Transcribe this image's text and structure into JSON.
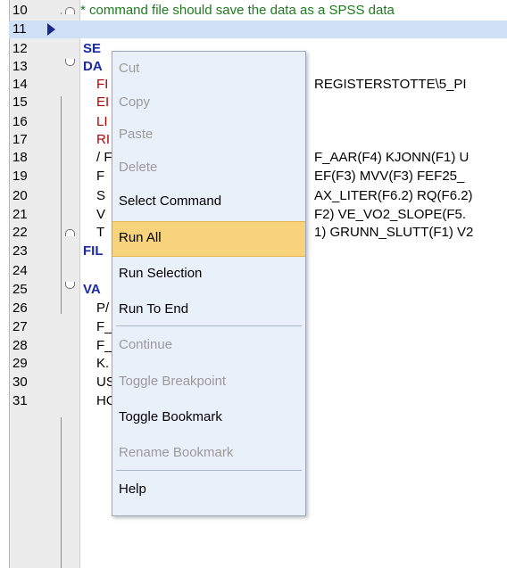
{
  "editor": {
    "lines": [
      {
        "num": "10",
        "text": "* command file should save the data as a SPSS data",
        "style": "comment",
        "marker": "fold-up"
      },
      {
        "num": "11",
        "text": "",
        "style": "plain",
        "marker": "current"
      },
      {
        "num": "12",
        "text": "SE",
        "style": "kw"
      },
      {
        "num": "13",
        "text": "DA",
        "style": "kw",
        "marker": "fold-down"
      },
      {
        "num": "14",
        "text": "FI",
        "style": "red",
        "right": "REGISTERSTOTTE\\5_PI"
      },
      {
        "num": "15",
        "text": "EI",
        "style": "red"
      },
      {
        "num": "16",
        "text": "LI",
        "style": "red"
      },
      {
        "num": "17",
        "text": "RI",
        "style": "red"
      },
      {
        "num": "18",
        "text": "/ F",
        "style": "text",
        "right": "F_AAR(F4) KJONN(F1) U"
      },
      {
        "num": "19",
        "text": "F",
        "style": "text",
        "right": "EF(F3) MVV(F3) FEF25_"
      },
      {
        "num": "20",
        "text": "S",
        "style": "text",
        "right": "AX_LITER(F6.2) RQ(F6.2)"
      },
      {
        "num": "21",
        "text": "V",
        "style": "text",
        "right": "F2) VE_VO2_SLOPE(F5."
      },
      {
        "num": "22",
        "text": "T",
        "style": "text",
        "right": "1) GRUNN_SLUTT(F1) V2",
        "marker": "fold-up"
      },
      {
        "num": "23",
        "text": "FIL",
        "style": "kw"
      },
      {
        "num": "24",
        "text": "",
        "style": "plain"
      },
      {
        "num": "25",
        "text": "VA",
        "style": "kw",
        "marker": "fold-down"
      },
      {
        "num": "26",
        "text": "P/",
        "style": "text"
      },
      {
        "num": "27",
        "text": "F_",
        "style": "text"
      },
      {
        "num": "28",
        "text": "F_",
        "style": "text"
      },
      {
        "num": "29",
        "text": "K.",
        "style": "text"
      },
      {
        "num": "30",
        "text": "US_DATO \"US_DATO\"",
        "style": "text"
      },
      {
        "num": "31",
        "text": "HOYDE \"HOYDE_CM\"",
        "style": "text"
      }
    ]
  },
  "context_menu": {
    "items": [
      {
        "label": "Cut",
        "enabled": false
      },
      {
        "label": "Copy",
        "enabled": false
      },
      {
        "label": "Paste",
        "enabled": false
      },
      {
        "label": "Delete",
        "enabled": false
      },
      {
        "label": "Select Command",
        "enabled": true
      },
      {
        "label": "Run All",
        "enabled": true,
        "highlighted": true
      },
      {
        "label": "Run Selection",
        "enabled": true
      },
      {
        "label": "Run To End",
        "enabled": true
      },
      {
        "label": "Continue",
        "enabled": false
      },
      {
        "label": "Toggle Breakpoint",
        "enabled": false
      },
      {
        "label": "Toggle Bookmark",
        "enabled": true
      },
      {
        "label": "Rename Bookmark",
        "enabled": false
      },
      {
        "label": "Help",
        "enabled": true
      }
    ]
  },
  "colors": {
    "gutter": "#ececec",
    "selected_line": "#cfe0f6",
    "menu_bg": "#eaf0fa",
    "menu_highlight": "#f7d37c",
    "comment": "#1f7a1f",
    "keyword": "#1a2aa0",
    "subcommand": "#b00000"
  }
}
